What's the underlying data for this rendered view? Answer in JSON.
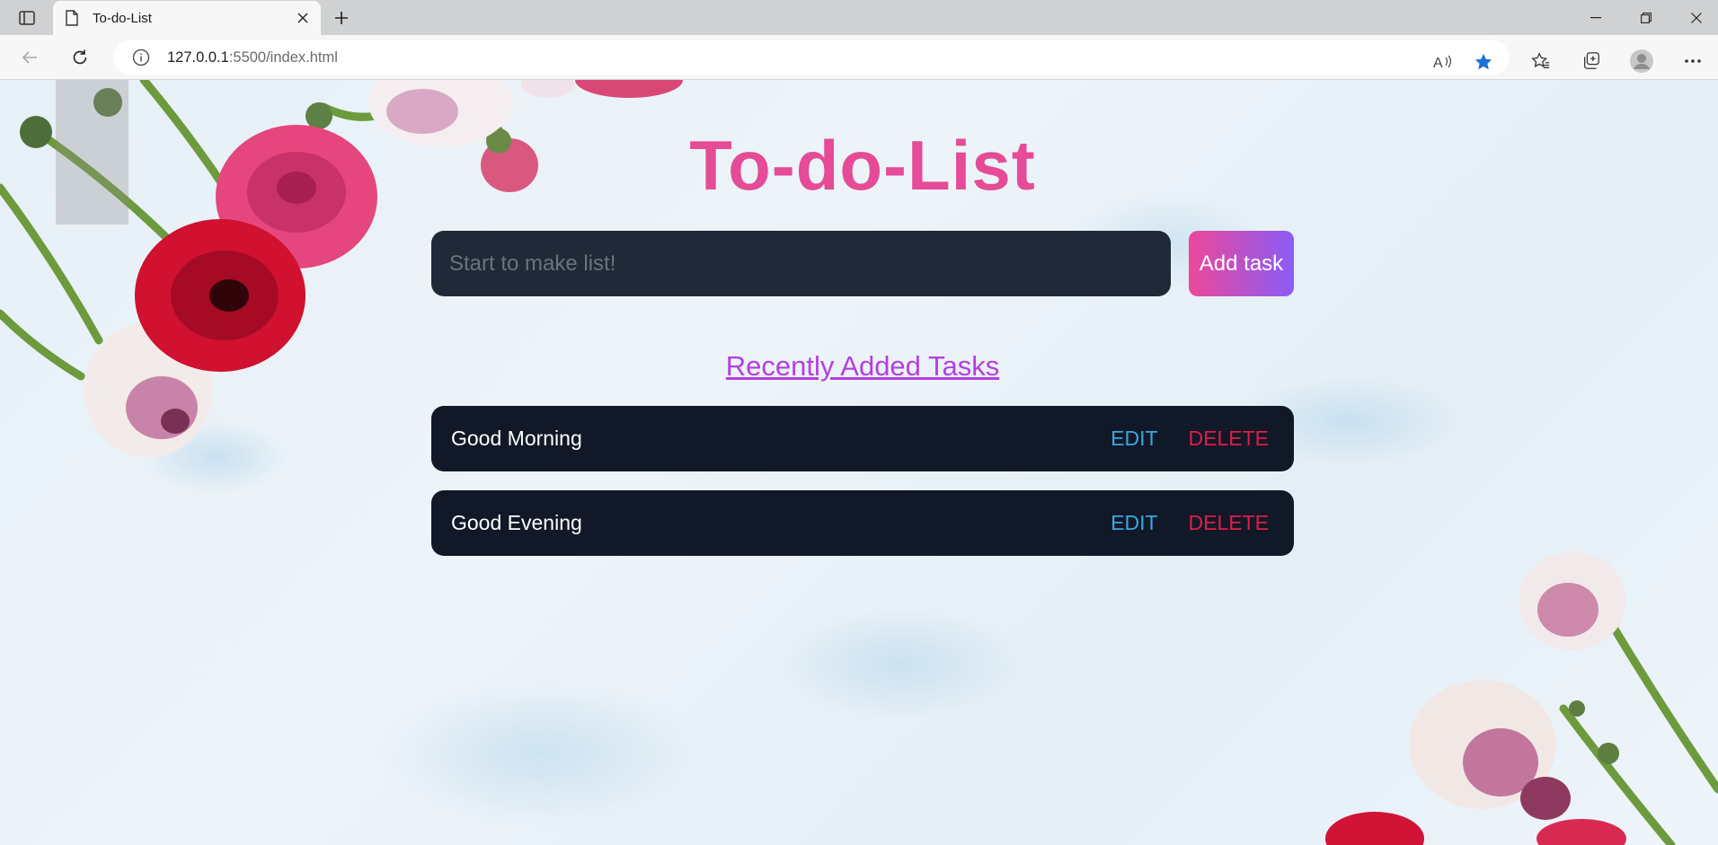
{
  "browser": {
    "tab_title": "To-do-List",
    "url_host": "127.0.0.1",
    "url_rest": ":5500/index.html",
    "new_tab_label": "+"
  },
  "page": {
    "title": "To-do-List",
    "input_placeholder": "Start to make list!",
    "input_value": "",
    "add_button_label": "Add task",
    "section_title": "Recently Added Tasks",
    "tasks": [
      {
        "text": "Good Morning",
        "edit_label": "EDIT",
        "delete_label": "DELETE"
      },
      {
        "text": "Good Evening",
        "edit_label": "EDIT",
        "delete_label": "DELETE"
      }
    ]
  },
  "colors": {
    "title": "#e54b96",
    "section_title": "#b43fe0",
    "edit": "#38a7e0",
    "delete": "#e11d48",
    "row_bg": "#111827",
    "input_bg": "#1f2937"
  }
}
